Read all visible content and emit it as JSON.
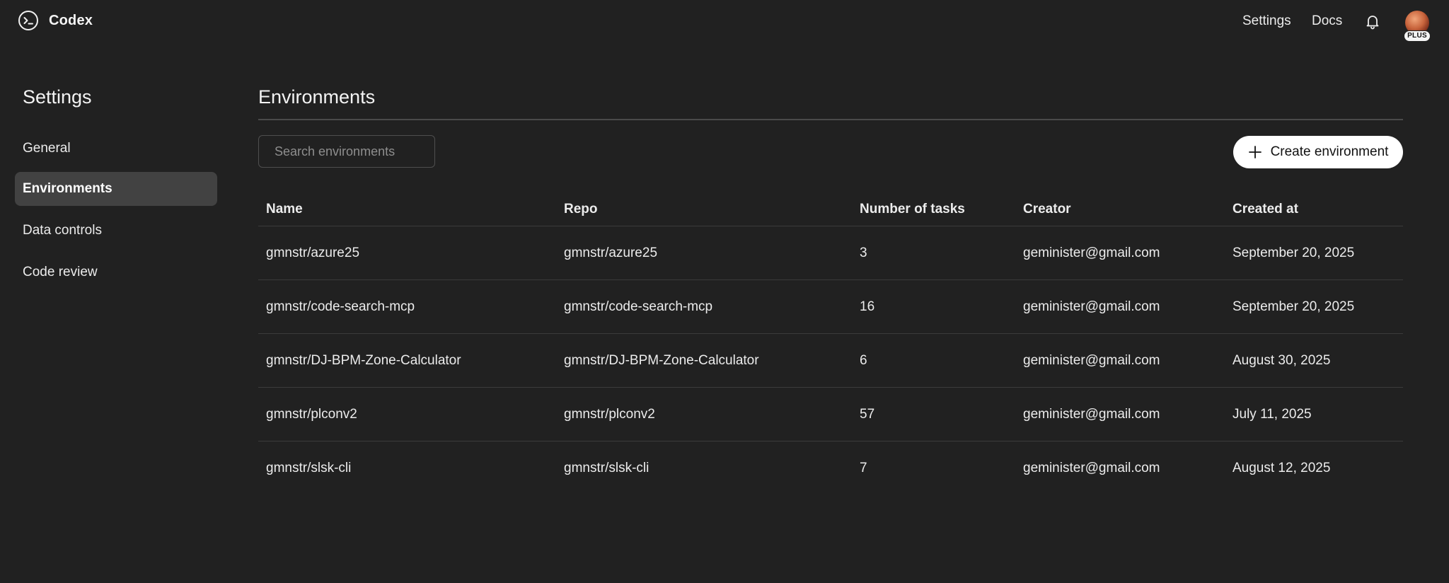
{
  "header": {
    "brand": "Codex",
    "links": {
      "settings": "Settings",
      "docs": "Docs"
    },
    "icons": {
      "brand": "codex-terminal-icon",
      "notifications": "bell-icon"
    },
    "avatar_badge": "PLUS"
  },
  "sidebar": {
    "title": "Settings",
    "items": [
      {
        "label": "General",
        "active": false
      },
      {
        "label": "Environments",
        "active": true
      },
      {
        "label": "Data controls",
        "active": false
      },
      {
        "label": "Code review",
        "active": false
      }
    ]
  },
  "main": {
    "title": "Environments",
    "search": {
      "placeholder": "Search environments",
      "value": ""
    },
    "create_button": {
      "label": "Create environment",
      "icon": "plus-icon"
    },
    "table": {
      "columns": [
        "Name",
        "Repo",
        "Number of tasks",
        "Creator",
        "Created at"
      ],
      "rows": [
        {
          "name": "gmnstr/azure25",
          "repo": "gmnstr/azure25",
          "tasks": "3",
          "creator": "geminister@gmail.com",
          "created": "September 20, 2025"
        },
        {
          "name": "gmnstr/code-search-mcp",
          "repo": "gmnstr/code-search-mcp",
          "tasks": "16",
          "creator": "geminister@gmail.com",
          "created": "September 20, 2025"
        },
        {
          "name": "gmnstr/DJ-BPM-Zone-Calculator",
          "repo": "gmnstr/DJ-BPM-Zone-Calculator",
          "tasks": "6",
          "creator": "geminister@gmail.com",
          "created": "August 30, 2025"
        },
        {
          "name": "gmnstr/plconv2",
          "repo": "gmnstr/plconv2",
          "tasks": "57",
          "creator": "geminister@gmail.com",
          "created": "July 11, 2025"
        },
        {
          "name": "gmnstr/slsk-cli",
          "repo": "gmnstr/slsk-cli",
          "tasks": "7",
          "creator": "geminister@gmail.com",
          "created": "August 12, 2025"
        }
      ]
    }
  },
  "colors": {
    "background": "#212121",
    "active_nav": "#424242",
    "text": "#ececec",
    "button_bg": "#ffffff",
    "divider": "#3b3b3b"
  }
}
